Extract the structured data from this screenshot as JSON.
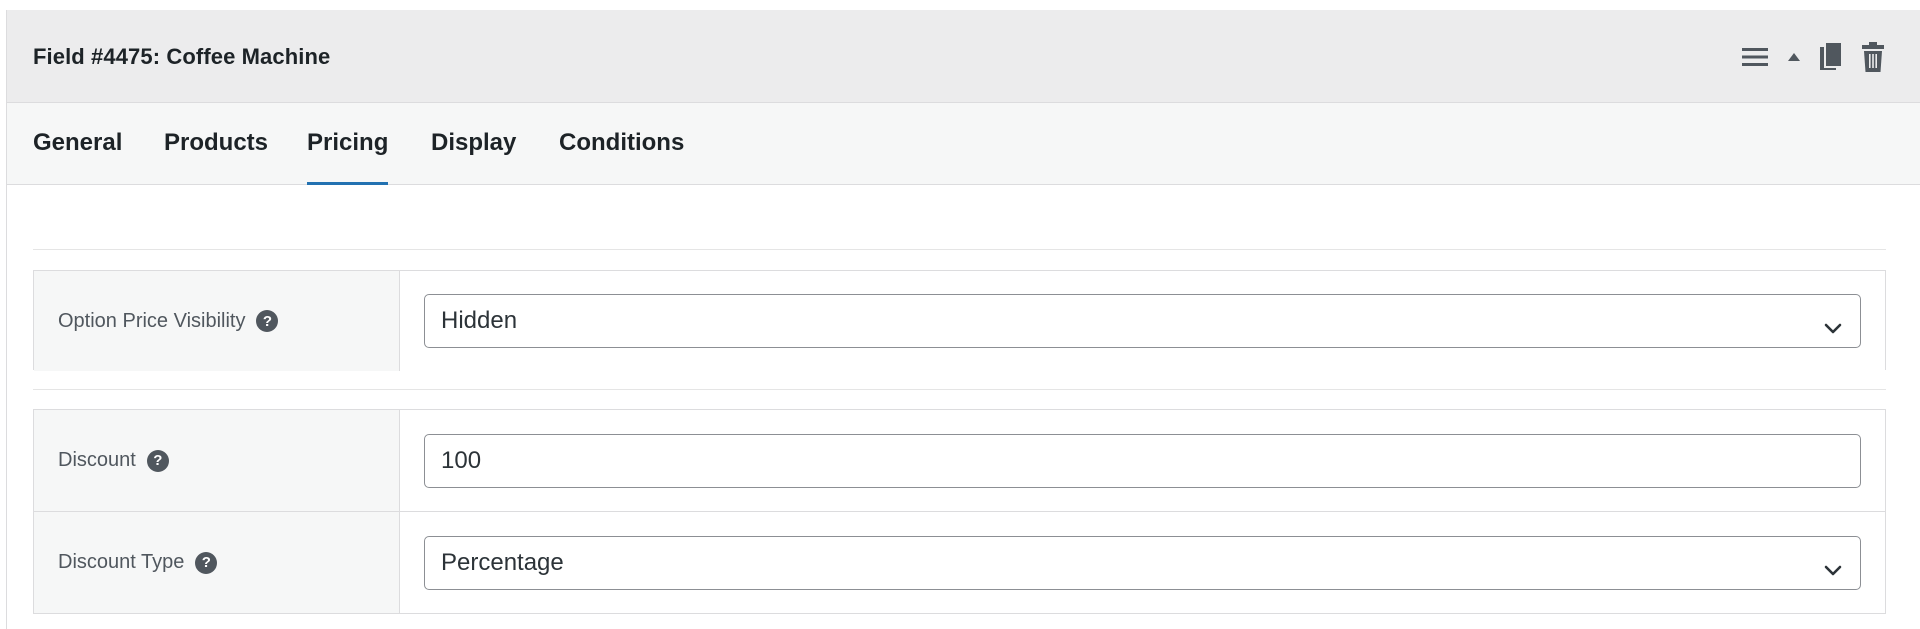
{
  "header": {
    "title": "Field #4475: Coffee Machine"
  },
  "header_icons": [
    "menu-icon",
    "collapse-arrow-icon",
    "duplicate-icon",
    "trash-icon"
  ],
  "tabs": [
    {
      "label": "General"
    },
    {
      "label": "Products"
    },
    {
      "label": "Pricing",
      "active": true
    },
    {
      "label": "Display"
    },
    {
      "label": "Conditions"
    }
  ],
  "pricing": {
    "option_price_visibility": {
      "label": "Option Price Visibility",
      "value": "Hidden"
    },
    "discount": {
      "label": "Discount",
      "value": "100"
    },
    "discount_type": {
      "label": "Discount Type",
      "value": "Percentage"
    }
  },
  "help_glyph": "?",
  "colors": {
    "accent": "#2271b1",
    "header_bg": "#ececed",
    "tabs_bg": "#f6f7f7",
    "icon": "#50575e"
  }
}
